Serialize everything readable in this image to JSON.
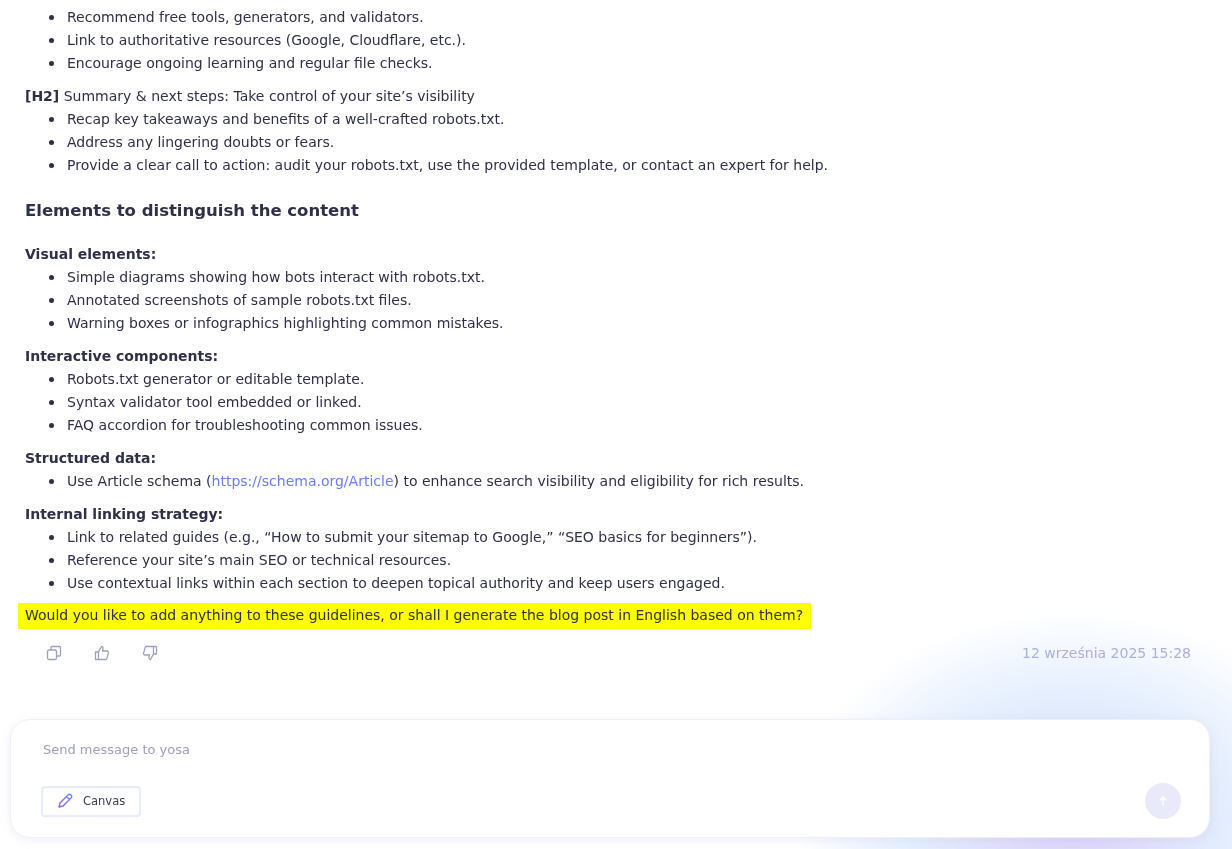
{
  "blocks": [
    {
      "kind": "list",
      "items": [
        {
          "text": "Recommend free tools, generators, and validators."
        },
        {
          "text": "Link to authoritative resources (Google, Cloudflare, etc.)."
        },
        {
          "text": "Encourage ongoing learning and regular file checks."
        }
      ]
    },
    {
      "kind": "group",
      "title": "**[H2]** Summary & next steps: Take control of your site’s visibility",
      "items": [
        {
          "text": "Recap key takeaways and benefits of a well-crafted robots.txt."
        },
        {
          "text": "Address any lingering doubts or fears."
        },
        {
          "text": "Provide a clear call to action: audit your robots.txt, use the provided template, or contact an expert for help."
        }
      ]
    },
    {
      "kind": "heading",
      "title": "Elements to distinguish the content"
    },
    {
      "kind": "group",
      "title": "**Visual elements:**",
      "items": [
        {
          "text": "Simple diagrams showing how bots interact with robots.txt."
        },
        {
          "text": "Annotated screenshots of sample robots.txt files."
        },
        {
          "text": "Warning boxes or infographics highlighting common mistakes."
        }
      ]
    },
    {
      "kind": "group",
      "title": "**Interactive components:**",
      "items": [
        {
          "text": "Robots.txt generator or editable template."
        },
        {
          "text": "Syntax validator tool embedded or linked."
        },
        {
          "text": "FAQ accordion for troubleshooting common issues."
        }
      ]
    },
    {
      "kind": "group",
      "title": "**Structured data:**",
      "items": [
        {
          "text": "Use Article schema (",
          "link": "https://schema.org/Article",
          "after": ") to enhance search visibility and eligibility for rich results."
        }
      ]
    },
    {
      "kind": "group",
      "title": "**Internal linking strategy:**",
      "items": [
        {
          "text": "Link to related guides (e.g., “How to submit your sitemap to Google,” “SEO basics for beginners”)."
        },
        {
          "text": "Reference your site’s main SEO or technical resources."
        },
        {
          "text": "Use contextual links within each section to deepen topical authority and keep users engaged."
        }
      ]
    }
  ],
  "question": "Would you like to add anything to these guidelines, or shall I generate the blog post in English based on them?",
  "timestamp": "12 września 2025 15:28",
  "composer": {
    "placeholder": "Send message to yosa",
    "canvas_button": "Canvas",
    "send_enabled": false
  }
}
